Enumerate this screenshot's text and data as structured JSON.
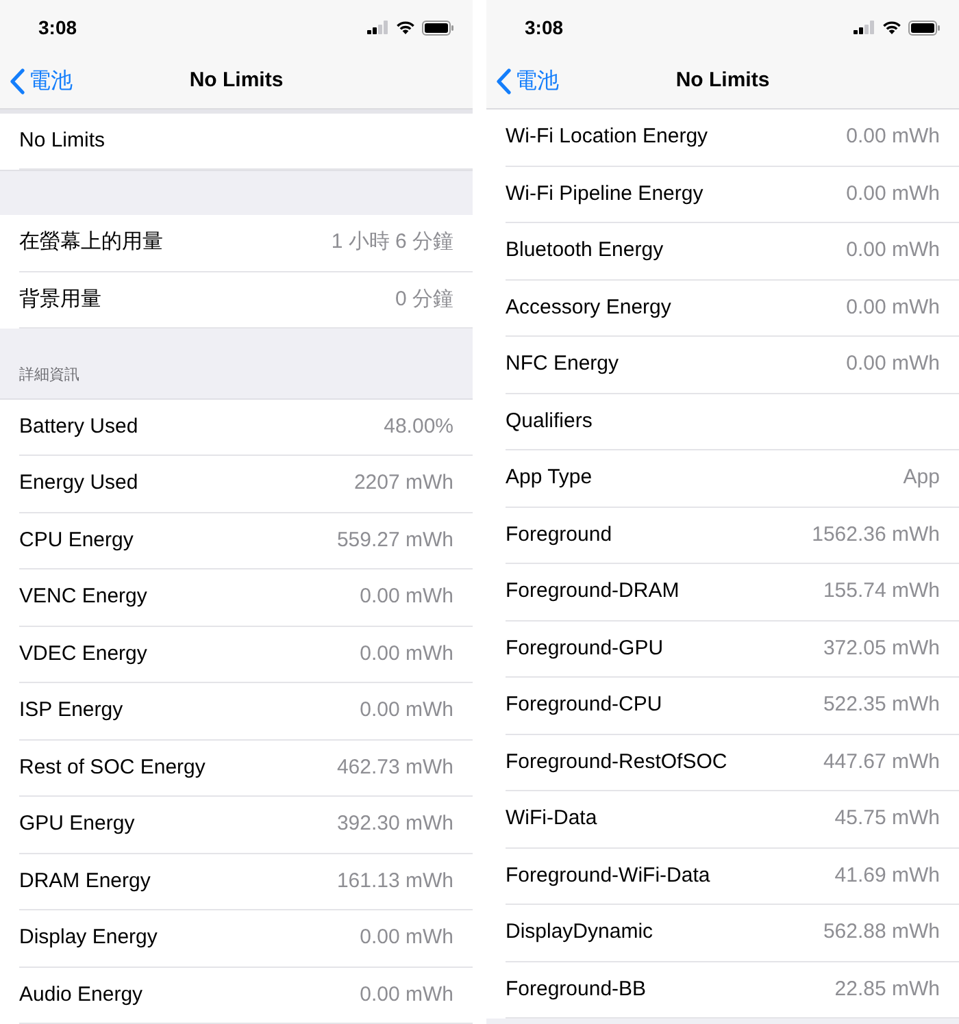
{
  "panels": [
    {
      "status": {
        "time": "3:08"
      },
      "nav": {
        "back": "電池",
        "title": "No Limits"
      },
      "items": [
        {
          "kind": "spacer"
        },
        {
          "kind": "row",
          "label": "No Limits"
        },
        {
          "kind": "gap"
        },
        {
          "kind": "row",
          "label": "在螢幕上的用量",
          "value": "1 小時 6 分鐘"
        },
        {
          "kind": "row",
          "label": "背景用量",
          "value": "0 分鐘"
        },
        {
          "kind": "header",
          "label": "詳細資訊"
        },
        {
          "kind": "row",
          "label": "Battery Used",
          "value": "48.00%"
        },
        {
          "kind": "row",
          "label": "Energy Used",
          "value": "2207 mWh"
        },
        {
          "kind": "row",
          "label": "CPU Energy",
          "value": "559.27 mWh"
        },
        {
          "kind": "row",
          "label": "VENC Energy",
          "value": "0.00 mWh"
        },
        {
          "kind": "row",
          "label": "VDEC Energy",
          "value": "0.00 mWh"
        },
        {
          "kind": "row",
          "label": "ISP Energy",
          "value": "0.00 mWh"
        },
        {
          "kind": "row",
          "label": "Rest of SOC Energy",
          "value": "462.73 mWh"
        },
        {
          "kind": "row",
          "label": "GPU Energy",
          "value": "392.30 mWh"
        },
        {
          "kind": "row",
          "label": "DRAM Energy",
          "value": "161.13 mWh"
        },
        {
          "kind": "row",
          "label": "Display Energy",
          "value": "0.00 mWh"
        },
        {
          "kind": "row",
          "label": "Audio Energy",
          "value": "0.00 mWh"
        }
      ]
    },
    {
      "status": {
        "time": "3:08"
      },
      "nav": {
        "back": "電池",
        "title": "No Limits"
      },
      "items": [
        {
          "kind": "row",
          "label": "Wi-Fi Location Energy",
          "value": "0.00 mWh"
        },
        {
          "kind": "row",
          "label": "Wi-Fi Pipeline Energy",
          "value": "0.00 mWh"
        },
        {
          "kind": "row",
          "label": "Bluetooth Energy",
          "value": "0.00 mWh"
        },
        {
          "kind": "row",
          "label": "Accessory Energy",
          "value": "0.00 mWh"
        },
        {
          "kind": "row",
          "label": "NFC Energy",
          "value": "0.00 mWh"
        },
        {
          "kind": "row",
          "label": "Qualifiers"
        },
        {
          "kind": "row",
          "label": "App Type",
          "value": "App"
        },
        {
          "kind": "row",
          "label": "Foreground",
          "value": "1562.36 mWh"
        },
        {
          "kind": "row",
          "label": "Foreground-DRAM",
          "value": "155.74 mWh"
        },
        {
          "kind": "row",
          "label": "Foreground-GPU",
          "value": "372.05 mWh"
        },
        {
          "kind": "row",
          "label": "Foreground-CPU",
          "value": "522.35 mWh"
        },
        {
          "kind": "row",
          "label": "Foreground-RestOfSOC",
          "value": "447.67 mWh"
        },
        {
          "kind": "row",
          "label": "WiFi-Data",
          "value": "45.75 mWh"
        },
        {
          "kind": "row",
          "label": "Foreground-WiFi-Data",
          "value": "41.69 mWh"
        },
        {
          "kind": "row",
          "label": "DisplayDynamic",
          "value": "562.88 mWh"
        },
        {
          "kind": "row",
          "label": "Foreground-BB",
          "value": "22.85 mWh"
        }
      ]
    }
  ]
}
